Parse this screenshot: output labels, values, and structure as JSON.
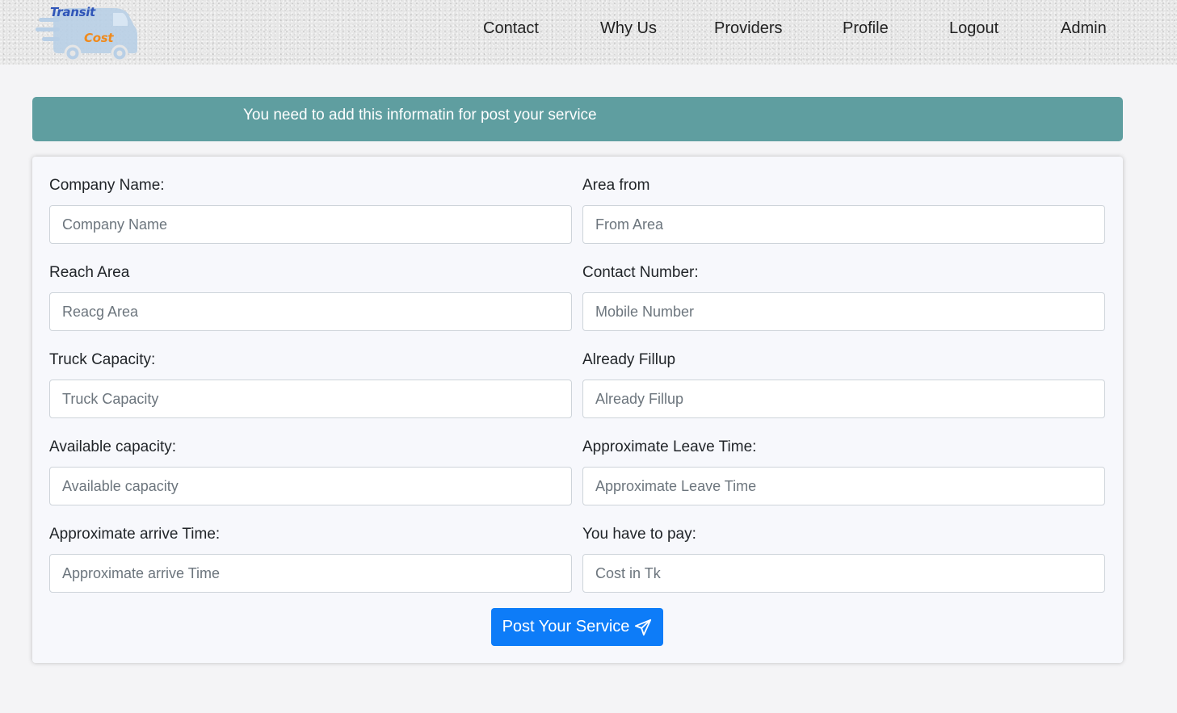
{
  "brand": {
    "word1": "Transit",
    "word2": "Cost",
    "colors": {
      "word1": "#2f55b8",
      "word2": "#f08a1c",
      "truck": "#b8cfe6"
    }
  },
  "nav": {
    "items": [
      {
        "label": "Contact"
      },
      {
        "label": "Why Us"
      },
      {
        "label": "Providers"
      },
      {
        "label": "Profile"
      },
      {
        "label": "Logout"
      },
      {
        "label": "Admin"
      }
    ]
  },
  "banner": {
    "text": "You need to add this informatin for post your service",
    "color": "#5f9ea0"
  },
  "form": {
    "fields": [
      {
        "label": "Company Name:",
        "placeholder": "Company Name",
        "value": ""
      },
      {
        "label": "Area from",
        "placeholder": "From Area",
        "value": ""
      },
      {
        "label": "Reach Area",
        "placeholder": "Reacg Area",
        "value": ""
      },
      {
        "label": "Contact Number:",
        "placeholder": "Mobile Number",
        "value": ""
      },
      {
        "label": "Truck Capacity:",
        "placeholder": "Truck Capacity",
        "value": ""
      },
      {
        "label": "Already Fillup",
        "placeholder": "Already Fillup",
        "value": ""
      },
      {
        "label": "Available capacity:",
        "placeholder": "Available capacity",
        "value": ""
      },
      {
        "label": "Approximate Leave Time:",
        "placeholder": "Approximate Leave Time",
        "value": ""
      },
      {
        "label": "Approximate arrive Time:",
        "placeholder": "Approximate arrive Time",
        "value": ""
      },
      {
        "label": "You have to pay:",
        "placeholder": "Cost in Tk",
        "value": ""
      }
    ],
    "submit": {
      "label": "Post Your Service",
      "icon": "paper-plane-icon",
      "color": "#0d7cf8"
    }
  }
}
